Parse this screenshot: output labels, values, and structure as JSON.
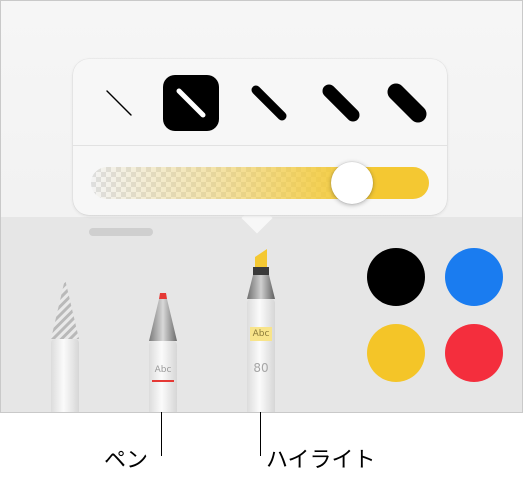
{
  "popover": {
    "thickness_options": [
      "line-thinnest-icon",
      "line-thin-icon",
      "line-medium-icon",
      "line-thick-icon",
      "line-thickest-icon"
    ],
    "selected_thickness_index": 1,
    "opacity_percent": 80,
    "opacity_color": "#f4c832"
  },
  "tools": {
    "pencil": {
      "name": "pencil-icon"
    },
    "pen": {
      "name": "pen-icon",
      "sample_text": "Abc",
      "ink_color": "#e53935"
    },
    "highlighter": {
      "name": "highlighter-icon",
      "sample_text": "Abc",
      "opacity_label": "80",
      "tip_color": "#f4c832"
    }
  },
  "swatches": [
    {
      "name": "black",
      "color": "#000000"
    },
    {
      "name": "blue",
      "color": "#1a7cf0"
    },
    {
      "name": "yellow",
      "color": "#f4c528"
    },
    {
      "name": "red",
      "color": "#f42e3d"
    }
  ],
  "callouts": {
    "pen": "ペン",
    "highlighter": "ハイライト"
  }
}
